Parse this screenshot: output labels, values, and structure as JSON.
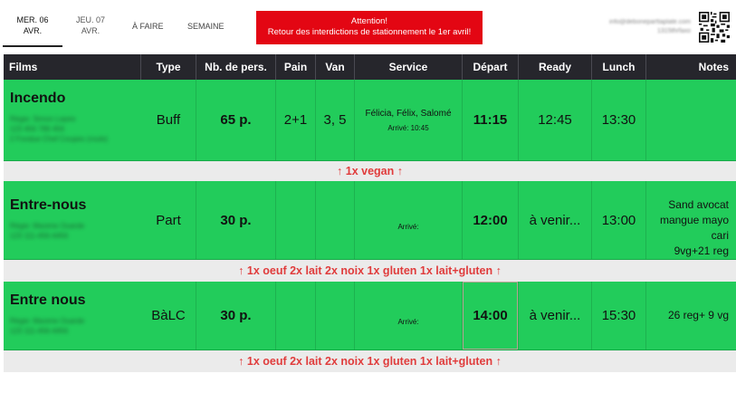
{
  "tabs": [
    {
      "day": "MER. 06",
      "date": "AVR."
    },
    {
      "day": "JEU. 07",
      "date": "AVR."
    }
  ],
  "nav": {
    "todo": "À FAIRE",
    "week": "SEMAINE"
  },
  "alert": {
    "title": "Attention!",
    "message": "Retour des interdictions de stationnement le 1er avril!"
  },
  "contact": {
    "email": "info@deboneparttaplate.com",
    "phone": "1315thrfaxo"
  },
  "columns": [
    "Films",
    "Type",
    "Nb. de pers.",
    "Pain",
    "Van",
    "Service",
    "Départ",
    "Ready",
    "Lunch",
    "Notes"
  ],
  "rows": [
    {
      "film": "Incendo",
      "sub": [
        "Régie: Simon Lepire",
        "123 456 789 456",
        "2 Fondue Chef Coupes (roule)"
      ],
      "type": "Buff",
      "people": "65 p.",
      "bread": "2+1",
      "van": "3, 5",
      "service": "Félicia, Félix, Salomé",
      "arrival": "Arrivé: 10:45",
      "depart": "11:15",
      "ready": "12:45",
      "lunch": "13:30",
      "notes": [],
      "band": "↑ 1x vegan ↑"
    },
    {
      "film": "Entre-nous",
      "sub": [
        "Régie: Maxime Ouarde",
        "123 111-456-4456"
      ],
      "type": "Part",
      "people": "30 p.",
      "bread": "",
      "van": "",
      "service": "",
      "arrival": "Arrivé:",
      "depart": "12:00",
      "ready": "à venir...",
      "lunch": "13:00",
      "notes": [
        "Sand avocat",
        "mangue mayo",
        "cari",
        "9vg+21 reg"
      ],
      "band": "↑ 1x oeuf 2x lait 2x noix 1x gluten 1x lait+gluten ↑"
    },
    {
      "film": "Entre nous",
      "sub": [
        "Régie: Maxime Ouarde",
        "123 111-456-4456"
      ],
      "type": "BàLC",
      "people": "30 p.",
      "bread": "",
      "van": "",
      "service": "",
      "arrival": "Arrivé:",
      "depart": "14:00",
      "ready": "à venir...",
      "lunch": "15:30",
      "notes": [
        "26 reg+ 9 vg"
      ],
      "band": "↑ 1x oeuf 2x lait 2x noix 1x gluten 1x lait+gluten ↑"
    }
  ],
  "colors": {
    "row_green": "#22cc5b",
    "header_bg": "#26262c",
    "alert_red": "#e30613",
    "band_text": "#e03c3c"
  }
}
